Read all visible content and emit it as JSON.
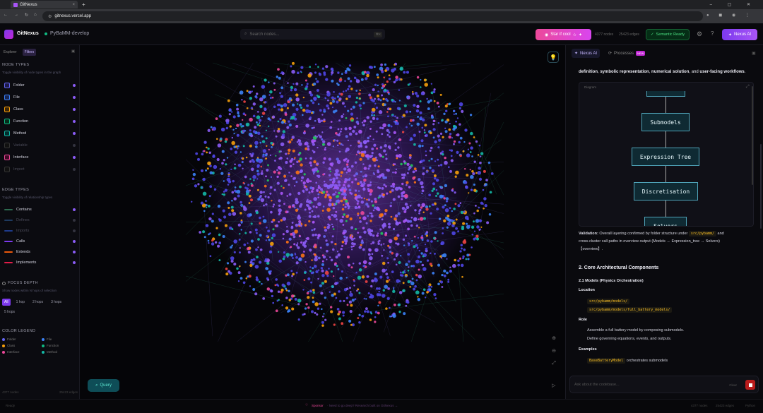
{
  "browser": {
    "tab_title": "GitNexus",
    "url": "gitnexus.vercel.app"
  },
  "header": {
    "app_name": "GitNexus",
    "repo": "PyBaMM-develop",
    "search_placeholder": "Search nodes...",
    "search_shortcut": "⌘K",
    "star_label": "Star if cool",
    "nodes_stat": "4377 nodes",
    "edges_stat": "25423 edges",
    "semantic_label": "Semantic Ready",
    "ai_label": "Nexus AI"
  },
  "left_panel": {
    "tabs": [
      "Explorer",
      "Filters"
    ],
    "node_types_title": "NODE TYPES",
    "node_types_sub": "Toggle visibility of node types in the graph",
    "node_types": [
      {
        "label": "Folder",
        "color": "#6366f1",
        "enabled": true
      },
      {
        "label": "File",
        "color": "#3b82f6",
        "enabled": true
      },
      {
        "label": "Class",
        "color": "#f59e0b",
        "enabled": true
      },
      {
        "label": "Function",
        "color": "#10b981",
        "enabled": true
      },
      {
        "label": "Method",
        "color": "#14b8a6",
        "enabled": true
      },
      {
        "label": "Variable",
        "color": "#64748b",
        "enabled": false
      },
      {
        "label": "Interface",
        "color": "#ec4899",
        "enabled": true
      },
      {
        "label": "Import",
        "color": "#475569",
        "enabled": false
      }
    ],
    "edge_types_title": "EDGE TYPES",
    "edge_types_sub": "Toggle visibility of relationship types",
    "edge_types": [
      {
        "label": "Contains",
        "color": "#2d6a4f",
        "enabled": true
      },
      {
        "label": "Defines",
        "color": "#1e3a5f",
        "enabled": false
      },
      {
        "label": "Imports",
        "color": "#1e3a8a",
        "enabled": false
      },
      {
        "label": "Calls",
        "color": "#7c3aed",
        "enabled": true
      },
      {
        "label": "Extends",
        "color": "#ea580c",
        "enabled": true
      },
      {
        "label": "Implements",
        "color": "#e11d48",
        "enabled": true
      }
    ],
    "focus_title": "FOCUS DEPTH",
    "focus_sub": "Show nodes within N hops of selection",
    "hops": [
      "All",
      "1 hop",
      "2 hops",
      "3 hops",
      "5 hops"
    ],
    "legend_title": "COLOR LEGEND",
    "legend": [
      {
        "label": "Folder",
        "color": "#6366f1"
      },
      {
        "label": "File",
        "color": "#3b82f6"
      },
      {
        "label": "Class",
        "color": "#f59e0b"
      },
      {
        "label": "Function",
        "color": "#10b981"
      },
      {
        "label": "Interface",
        "color": "#ec4899"
      },
      {
        "label": "Method",
        "color": "#14b8a6"
      }
    ],
    "footer_nodes": "4377 nodes",
    "footer_edges": "25423 edges"
  },
  "graph": {
    "query_label": "Query"
  },
  "right_panel": {
    "tab_ai": "Nexus AI",
    "tab_processes": "Processes",
    "badge_new": "NEW",
    "intro_parts": [
      "definition",
      ", ",
      "symbolic representation",
      ", ",
      "numerical solution",
      ", and ",
      "user-facing workflows",
      "."
    ],
    "diagram_label": "Diagram",
    "flow": [
      "Submodels",
      "Expression Tree",
      "Discretisation",
      "Solvers"
    ],
    "validation_label": "Validation:",
    "validation_text_1": " Overall layering confirmed by folder structure under ",
    "validation_code": "src/pybamm/",
    "validation_text_2": " and",
    "validation_text_3": "cross-cluster call paths in overview output (Models → Expression_tree → Solvers)",
    "validation_text_4": "【overview】.",
    "h2": "2. Core Architectural Components",
    "h3": "2.1 Models (Physics Orchestration)",
    "location_label": "Location",
    "location_codes": [
      "src/pybamm/models/",
      "src/pybamm/models/full_battery_models/"
    ],
    "role_label": "Role",
    "role_items": [
      "Assemble a full battery model by composing submodels.",
      "Define governing equations, events, and outputs."
    ],
    "examples_label": "Examples",
    "example_code": "BaseBatteryModel",
    "example_text": " orchestrates submodels",
    "ask_placeholder": "Ask about the codebase...",
    "clear_label": "Clear"
  },
  "status_bar": {
    "left": "Ready",
    "center_label": "Sponsor",
    "center_text": "· Need to go deep? Research built on GitNexus →",
    "right_items": [
      "4377 nodes",
      "25423 edges",
      "Python"
    ]
  }
}
